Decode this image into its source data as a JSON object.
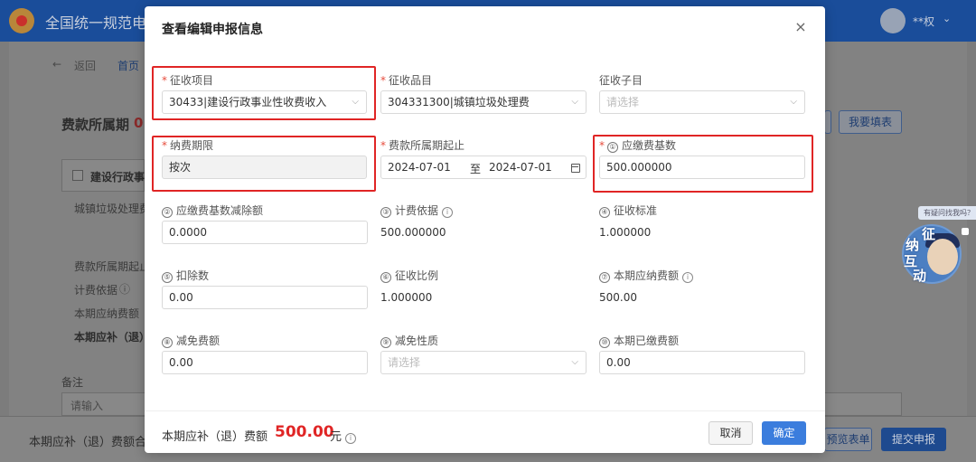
{
  "app": {
    "title": "全国统一规范电",
    "user": "**权"
  },
  "background": {
    "back_label": "返回",
    "crumb_home": "首页",
    "period_title": "费款所属期",
    "period_value_partial": "0",
    "fill_report_button": "我要填表",
    "section_checkbox_label": "建设行政事",
    "row_item_text": "城镇垃圾处理费",
    "label_period_range": "费款所属期起止",
    "label_basis": "计费依据",
    "label_due_amount": "本期应纳费额",
    "label_refund": "本期应补（退）",
    "remark_label": "备注",
    "remark_placeholder": "请输入",
    "footer_total_label": "本期应补（退）费额合",
    "preview_button": "预览表单",
    "submit_button": "提交申报"
  },
  "widget": {
    "bubble": "有疑问找我吗？",
    "chars": [
      "征",
      "纳",
      "互",
      "动"
    ]
  },
  "modal": {
    "title": "查看编辑申报信息",
    "close_icon": "×",
    "fields": {
      "levy_item": {
        "label": "征收项目",
        "value": "30433|建设行政事业性收费收入"
      },
      "levy_category": {
        "label": "征收品目",
        "value": "304331300|城镇垃圾处理费"
      },
      "levy_subitem": {
        "label": "征收子目",
        "placeholder": "请选择"
      },
      "payment_period": {
        "label": "纳费期限",
        "value": "按次"
      },
      "period_range": {
        "label": "费款所属期起止",
        "start": "2024-07-01",
        "separator": "至",
        "end": "2024-07-01"
      },
      "base_amount": {
        "num": "①",
        "label": "应缴费基数",
        "value": "500.000000"
      },
      "base_deduction": {
        "num": "②",
        "label": "应缴费基数减除额",
        "value": "0.0000"
      },
      "billing_basis": {
        "num": "③",
        "label": "计费依据",
        "value": "500.000000"
      },
      "levy_standard": {
        "num": "④",
        "label": "征收标准",
        "value": "1.000000"
      },
      "deduction": {
        "num": "⑤",
        "label": "扣除数",
        "value": "0.00"
      },
      "levy_ratio": {
        "num": "⑥",
        "label": "征收比例",
        "value": "1.000000"
      },
      "payable_amount": {
        "num": "⑦",
        "label": "本期应纳费额",
        "value": "500.00"
      },
      "reduction_amount": {
        "num": "⑧",
        "label": "减免费额",
        "value": "0.00"
      },
      "reduction_nature": {
        "num": "⑨",
        "label": "减免性质",
        "placeholder": "请选择"
      },
      "paid_amount": {
        "num": "⑩",
        "label": "本期已缴费额",
        "value": "0.00"
      }
    },
    "footer": {
      "label": "本期应补（退）费额",
      "amount": "500.00",
      "unit": "元",
      "cancel": "取消",
      "confirm": "确定"
    }
  },
  "colors": {
    "primary": "#3b7ddd",
    "highlight_box": "#e02525",
    "amount": "#e02525",
    "header_bg": "#1a4d9a"
  }
}
